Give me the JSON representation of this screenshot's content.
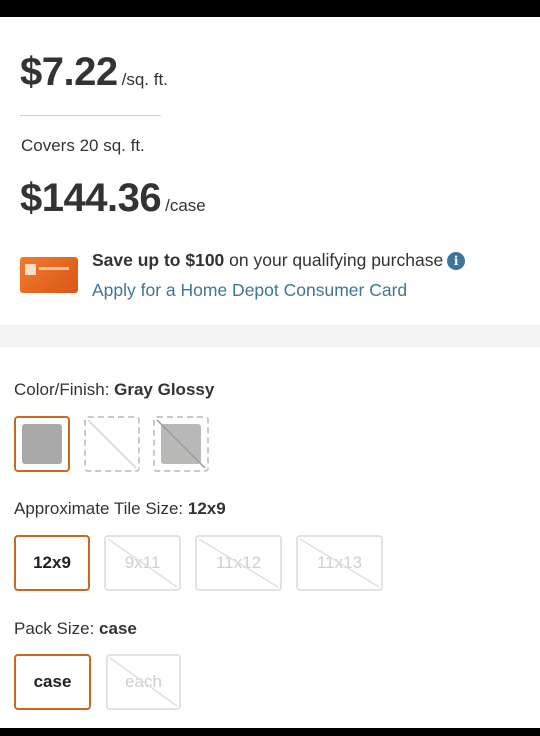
{
  "pricing": {
    "unit_price": "$7.22",
    "unit_label": "/sq. ft.",
    "coverage": "Covers 20 sq. ft.",
    "case_price": "$144.36",
    "case_label": "/case"
  },
  "promo": {
    "save_bold": "Save up to $100",
    "save_rest": " on your qualifying purchase",
    "info_icon": "i",
    "link_text": "Apply for a Home Depot Consumer Card"
  },
  "color_finish": {
    "label": "Color/Finish: ",
    "selected": "Gray Glossy",
    "swatches": [
      {
        "name": "Gray Glossy",
        "available": true,
        "selected": true,
        "color": "#a8a8a8"
      },
      {
        "name": "unavailable",
        "available": false,
        "selected": false,
        "color": "#ffffff"
      },
      {
        "name": "light gray",
        "available": true,
        "selected": false,
        "color": "#b9bab8"
      }
    ]
  },
  "tile_size": {
    "label": "Approximate Tile Size: ",
    "selected": "12x9",
    "options": [
      {
        "label": "12x9",
        "available": true,
        "selected": true
      },
      {
        "label": "9x11",
        "available": false,
        "selected": false
      },
      {
        "label": "11x12",
        "available": false,
        "selected": false
      },
      {
        "label": "11x13",
        "available": false,
        "selected": false
      }
    ]
  },
  "pack_size": {
    "label": "Pack Size: ",
    "selected": "case",
    "options": [
      {
        "label": "case",
        "available": true,
        "selected": true
      },
      {
        "label": "each",
        "available": false,
        "selected": false
      }
    ]
  },
  "colors": {
    "accent": "#c8691f",
    "link": "#3e7697",
    "text": "#333333"
  }
}
